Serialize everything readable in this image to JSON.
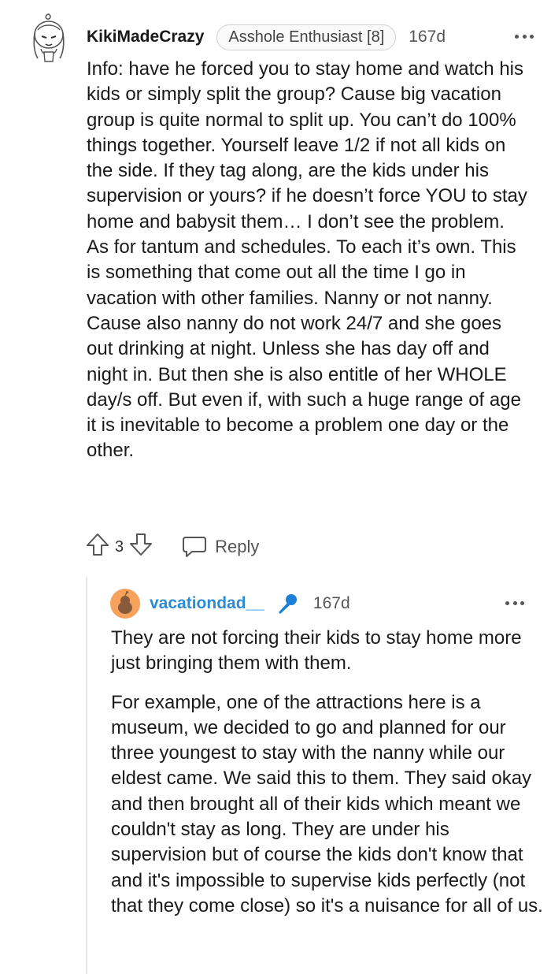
{
  "comment": {
    "username": "KikiMadeCrazy",
    "flair": "Asshole Enthusiast [8]",
    "age": "167d",
    "body": "Info: have he forced you to stay home and watch his kids or simply split the group? Cause big vacation group is quite normal to split up. You can’t do 100% things together. Yourself leave 1/2 if not all kids on the side. If they tag along, are the kids under his supervision or yours? if he doesn’t force YOU to stay home and babysit them… I don’t see the problem. As for tantum and schedules. To each it’s own. This is something that come out all the time I go in vacation with other families. Nanny or not nanny. Cause also nanny do not work 24/7 and she goes out drinking at night. Unless she has day off and night in. But then she is also entitle of her WHOLE day/s off. But even if, with such a huge range of age it is inevitable to become a problem one day or the other.",
    "score": "3",
    "reply_label": "Reply"
  },
  "reply": {
    "username": "vacationdad__",
    "age": "167d",
    "paragraphs": [
      "They are not forcing their kids to stay home more just bringing them with them.",
      "For example, one of the attractions here is a museum, we decided to go and planned for our three youngest to stay with the nanny while our eldest came. We said this to them. They said okay and then brought all of their kids which meant we couldn't stay as long. They are under his supervision but of course the kids don't know that and it's impossible to supervise kids perfectly (not that they come close) so it's a nuisance for all of us."
    ]
  },
  "icons": {
    "avatar": "cartoon-avatar-icon",
    "more": "more-dots-icon",
    "upvote": "upvote-arrow-icon",
    "downvote": "downvote-arrow-icon",
    "reply": "chat-bubble-icon",
    "reply_avatar": "snoo-avatar-icon",
    "mic": "microphone-icon"
  },
  "colors": {
    "username_op": "#2b8bd4",
    "mic": "#1c80d6",
    "avatar_orange": "#f6a25c"
  }
}
